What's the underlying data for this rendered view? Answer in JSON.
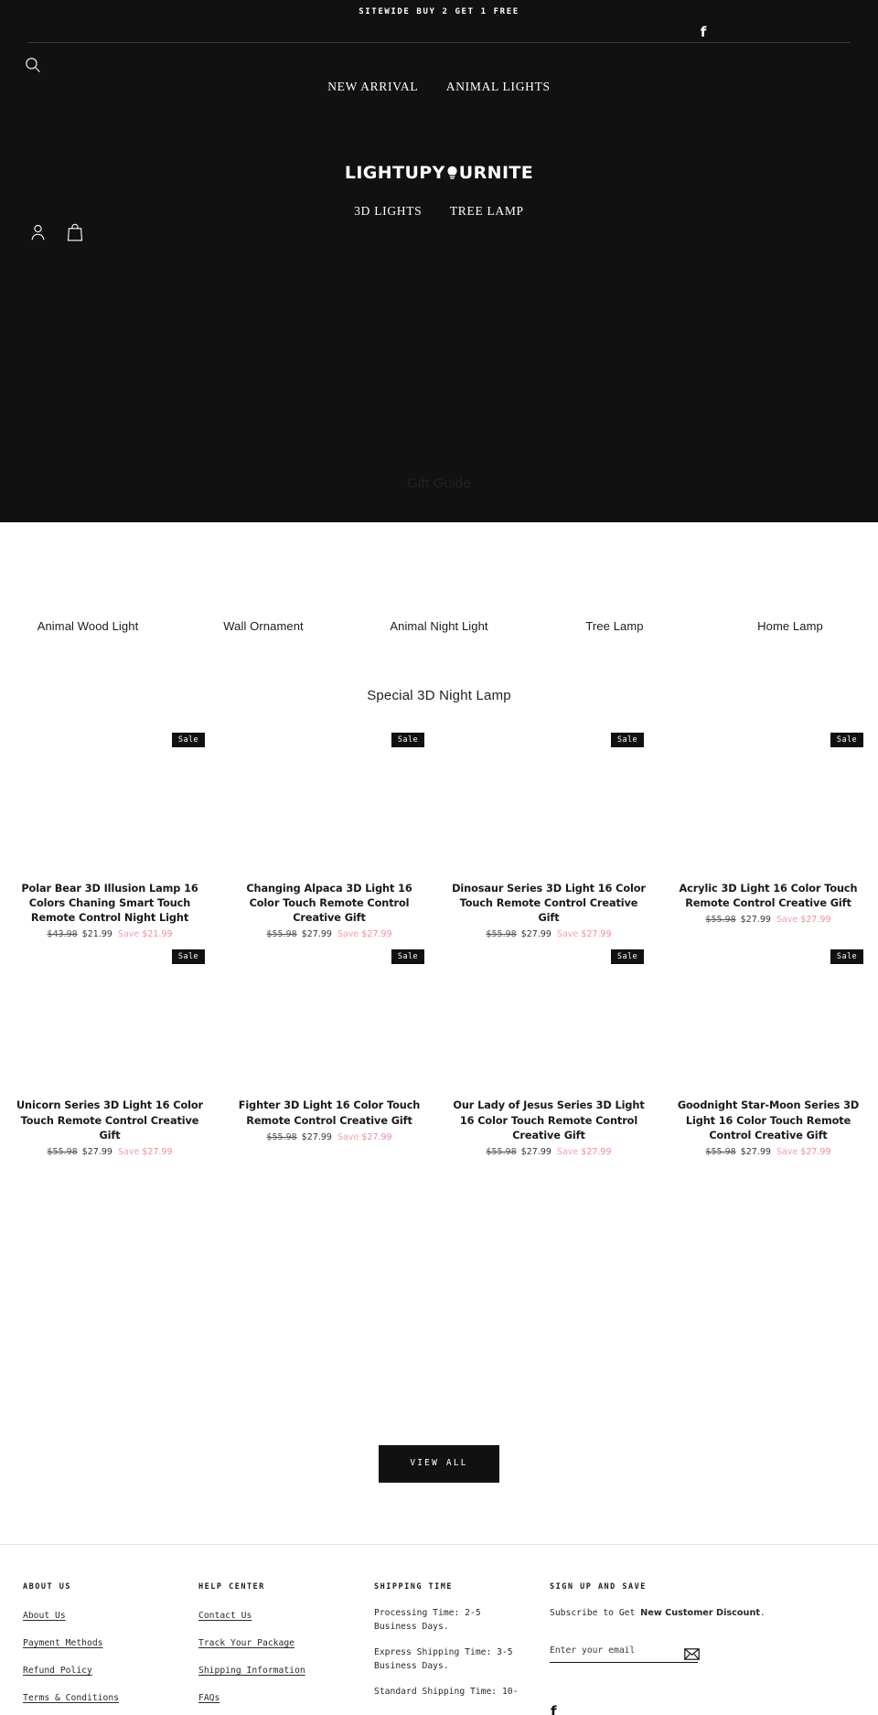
{
  "announcement": {
    "text": "SITEWIDE BUY 2 GET 1 FREE"
  },
  "header": {
    "social": {
      "facebook_icon": "facebook-icon"
    },
    "search_icon": "search-icon",
    "logo": {
      "text_before": "LIGHTUPY",
      "bulb_icon": "lightbulb-icon",
      "text_after": "URNITE",
      "full": "LIGHTUPYOURNITE"
    },
    "nav_top": [
      {
        "label": "NEW ARRIVAL"
      },
      {
        "label": "ANIMAL LIGHTS"
      }
    ],
    "nav_bottom": [
      {
        "label": "3D LIGHTS"
      },
      {
        "label": "TREE LAMP"
      }
    ],
    "account_icon": "user-account-icon",
    "cart_icon": "shopping-bag-icon"
  },
  "gift_guide": {
    "title": "Gift Guide",
    "categories": [
      {
        "label": "Animal Wood Light"
      },
      {
        "label": "Wall Ornament"
      },
      {
        "label": "Animal Night Light"
      },
      {
        "label": "Tree Lamp"
      },
      {
        "label": "Home Lamp"
      }
    ]
  },
  "special_section": {
    "title": "Special 3D Night Lamp",
    "badge_label": "Sale",
    "save_label": "Save",
    "view_all_label": "VIEW ALL",
    "products": [
      {
        "title": "Polar Bear 3D Illusion Lamp 16 Colors Chaning Smart Touch Remote Control Night Light",
        "compare_at": "$43.98",
        "price": "$21.99",
        "save": "$21.99",
        "badge": "Sale"
      },
      {
        "title": "Changing Alpaca 3D Light 16 Color Touch Remote Control Creative Gift",
        "compare_at": "$55.98",
        "price": "$27.99",
        "save": "$27.99",
        "badge": "Sale"
      },
      {
        "title": "Dinosaur Series 3D Light 16 Color Touch Remote Control Creative Gift",
        "compare_at": "$55.98",
        "price": "$27.99",
        "save": "$27.99",
        "badge": "Sale"
      },
      {
        "title": "Acrylic 3D Light 16 Color Touch Remote Control Creative Gift",
        "compare_at": "$55.98",
        "price": "$27.99",
        "save": "$27.99",
        "badge": "Sale"
      },
      {
        "title": "Unicorn Series 3D Light 16 Color Touch Remote Control Creative Gift",
        "compare_at": "$55.98",
        "price": "$27.99",
        "save": "$27.99",
        "badge": "Sale"
      },
      {
        "title": "Fighter 3D Light 16 Color Touch Remote Control Creative Gift",
        "compare_at": "$55.98",
        "price": "$27.99",
        "save": "$27.99",
        "badge": "Sale"
      },
      {
        "title": "Our Lady of Jesus Series 3D Light 16 Color Touch Remote Control Creative Gift",
        "compare_at": "$55.98",
        "price": "$27.99",
        "save": "$27.99",
        "badge": "Sale"
      },
      {
        "title": "Goodnight Star-Moon Series 3D Light 16 Color Touch Remote Control Creative Gift",
        "compare_at": "$55.98",
        "price": "$27.99",
        "save": "$27.99",
        "badge": "Sale"
      }
    ]
  },
  "footer": {
    "columns": [
      {
        "heading": "ABOUT US",
        "links": [
          {
            "label": "About Us"
          },
          {
            "label": "Payment Methods"
          },
          {
            "label": "Refund Policy"
          },
          {
            "label": "Terms & Conditions"
          }
        ]
      },
      {
        "heading": "HELP CENTER",
        "links": [
          {
            "label": "Contact Us"
          },
          {
            "label": "Track Your Package"
          },
          {
            "label": "Shipping Information"
          },
          {
            "label": "FAQs"
          }
        ]
      }
    ],
    "shipping": {
      "heading": "SHIPPING TIME",
      "lines": [
        "Processing Time: 2-5 Business Days.",
        "Express Shipping Time: 3-5 Business Days.",
        "Standard Shipping Time: 10-"
      ]
    },
    "signup": {
      "heading": "SIGN UP AND SAVE",
      "subscribe_prefix": "Subscribe to Get ",
      "subscribe_strong": "New Customer Discount",
      "subscribe_suffix": ".",
      "email_placeholder": "Enter your email",
      "email_value": "",
      "submit_icon": "envelope-icon",
      "facebook_icon": "facebook-icon"
    }
  },
  "colors": {
    "dark": "#111111",
    "page_bg": "#ffffff",
    "sale_pink": "#ef8d97",
    "muted": "#555555"
  }
}
